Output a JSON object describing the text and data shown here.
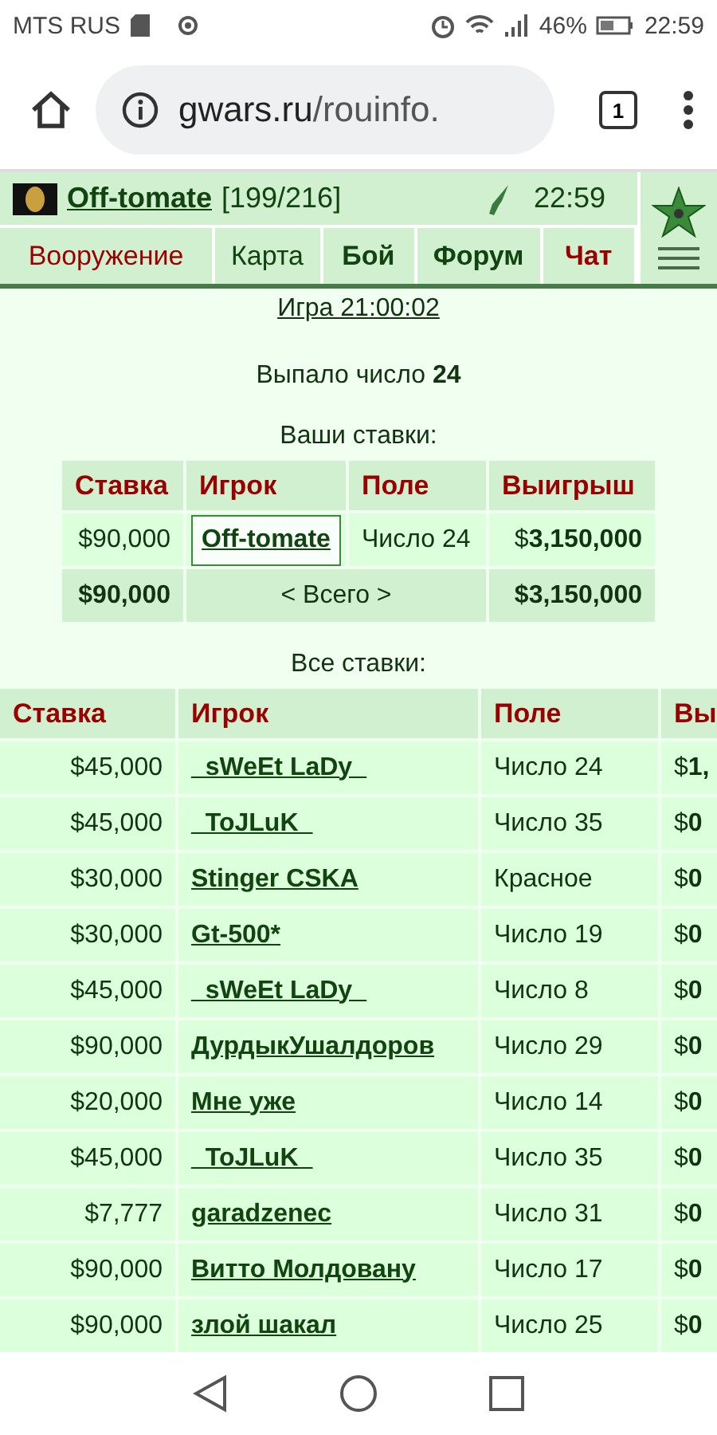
{
  "status_bar": {
    "carrier": "MTS RUS",
    "battery": "46%",
    "time": "22:59"
  },
  "browser": {
    "url_host": "gwars.ru",
    "url_path": "/rouinfo.",
    "tabs_count": "1"
  },
  "header": {
    "player": "Off-tomate",
    "hp": "[199/216]",
    "time": "22:59"
  },
  "nav": [
    {
      "label": "Вооружение",
      "kind": "red"
    },
    {
      "label": "Карта",
      "kind": "plain"
    },
    {
      "label": "Бой",
      "kind": "bold"
    },
    {
      "label": "Форум",
      "kind": "bold"
    },
    {
      "label": "Чат",
      "kind": "redbold"
    }
  ],
  "game_link": "Игра 21:00:02",
  "result": "Выпало число **24**",
  "your_bets": {
    "title": "Ваши ставки:",
    "columns": [
      "Ставка",
      "Игрок",
      "Поле",
      "Выигрыш"
    ],
    "rows": [
      {
        "bet": "$90,000",
        "player": "Off-tomate",
        "field": "Число 24",
        "win": "$**3,150,000**"
      }
    ],
    "total": {
      "bet": "$90,000",
      "label": "< Всего >",
      "win": "$3,150,000"
    }
  },
  "all_bets": {
    "title": "Все ставки:",
    "columns": [
      "Ставка",
      "Игрок",
      "Поле",
      "Вы"
    ],
    "rows": [
      {
        "bet": "$45,000",
        "player": "_sWeEt LaDy_",
        "field": "Число 24",
        "win": "$**1,**"
      },
      {
        "bet": "$45,000",
        "player": "_ToJLuK_",
        "field": "Число 35",
        "win": "$**0**"
      },
      {
        "bet": "$30,000",
        "player": "Stinger CSKA",
        "field": "Красное",
        "win": "$**0**"
      },
      {
        "bet": "$30,000",
        "player": "Gt-500*",
        "field": "Число 19",
        "win": "$**0**"
      },
      {
        "bet": "$45,000",
        "player": "_sWeEt LaDy_",
        "field": "Число 8",
        "win": "$**0**"
      },
      {
        "bet": "$90,000",
        "player": "ДурдыкУшалдоров",
        "field": "Число 29",
        "win": "$**0**"
      },
      {
        "bet": "$20,000",
        "player": "Мне уже",
        "field": "Число 14",
        "win": "$**0**"
      },
      {
        "bet": "$45,000",
        "player": "_ToJLuK_",
        "field": "Число 35",
        "win": "$**0**"
      },
      {
        "bet": "$7,777",
        "player": "garadzenec",
        "field": "Число 31",
        "win": "$**0**"
      },
      {
        "bet": "$90,000",
        "player": "Витто Молдовану",
        "field": "Число 17",
        "win": "$**0**"
      },
      {
        "bet": "$90,000",
        "player": "злой шакал",
        "field": "Число 25",
        "win": "$**0**"
      }
    ]
  }
}
